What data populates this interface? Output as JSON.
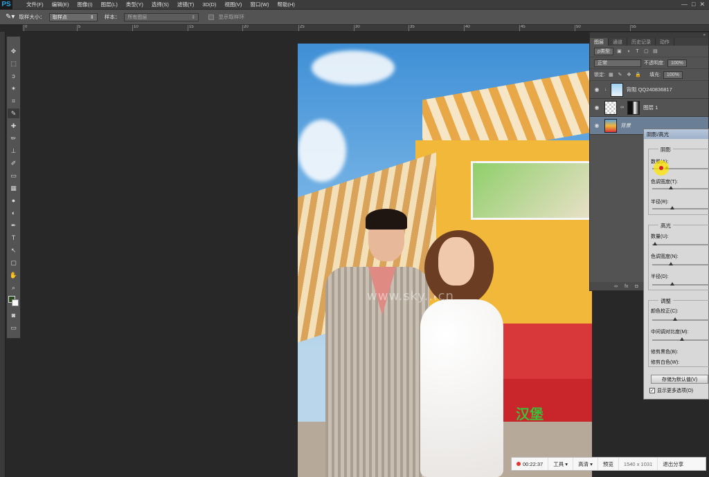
{
  "app": {
    "logo": "PS"
  },
  "menu": [
    "文件(F)",
    "编辑(E)",
    "图像(I)",
    "图层(L)",
    "类型(Y)",
    "选择(S)",
    "滤镜(T)",
    "3D(D)",
    "视图(V)",
    "窗口(W)",
    "帮助(H)"
  ],
  "window_controls": [
    "—",
    "□",
    "✕"
  ],
  "options_bar": {
    "sample_size_label": "取样大小：",
    "sample_size_value": "取样点",
    "sample_label": "样本：",
    "sample_value": "所有图层",
    "show_ring_label": "显示取样环"
  },
  "ruler_ticks": [
    "0",
    "5",
    "10",
    "15",
    "20",
    "25",
    "30",
    "35",
    "40",
    "45",
    "50",
    "55"
  ],
  "tools": [
    "move-icon",
    "marquee-icon",
    "lasso-icon",
    "magic-wand-icon",
    "crop-icon",
    "eyedropper-icon",
    "healing-icon",
    "brush-icon",
    "stamp-icon",
    "history-brush-icon",
    "eraser-icon",
    "gradient-icon",
    "blur-icon",
    "dodge-icon",
    "pen-icon",
    "type-icon",
    "path-select-icon",
    "shape-icon",
    "hand-icon",
    "zoom-icon"
  ],
  "tool_glyphs": [
    "✥",
    "⬚",
    "ↄ",
    "✶",
    "⌗",
    "✎",
    "✚",
    "✏",
    "⊥",
    "✐",
    "▭",
    "▦",
    "●",
    "◐",
    "✒",
    "T",
    "↖",
    "▢",
    "✋",
    "⌕"
  ],
  "colors": {
    "foreground": "#2d4a1f",
    "background": "#ffffff",
    "accent": "#2aa4e8"
  },
  "photo": {
    "watermark": "www.sky...cn",
    "sign_text": "汉堡"
  },
  "layers_panel": {
    "tabs": [
      "图层",
      "通道",
      "历史记录",
      "动作"
    ],
    "kind_label": "ρ类型",
    "blend_mode": "正常",
    "opacity_label": "不透明度:",
    "opacity_value": "100%",
    "lock_label": "锁定:",
    "fill_label": "填充:",
    "fill_value": "100%",
    "layers": [
      {
        "name": "背阻 QQ240836817",
        "thumb": "blue",
        "selected": false
      },
      {
        "name": "图层 1",
        "thumb": "checker",
        "selected": false
      },
      {
        "name": "背景",
        "thumb": "photo",
        "selected": true
      }
    ],
    "footer_icons": [
      "∞",
      "fx",
      "◘",
      "◑",
      "▭",
      "▤",
      "🗑"
    ]
  },
  "dialog": {
    "title": "阴影/高光",
    "shadows": {
      "title": "阴影",
      "amount": "数量(A):",
      "tone": "色调宽度(T):",
      "radius": "半径(R):"
    },
    "highlights": {
      "title": "高光",
      "amount": "数量(U):",
      "tone": "色调宽度(N):",
      "radius": "半径(D):"
    },
    "adjust": {
      "title": "调整",
      "color": "颜色校正(C):",
      "midtone": "中间调对比度(M):",
      "black": "修剪黑色(B):",
      "white": "修剪白色(W):"
    },
    "save_default": "存储为默认值(V)",
    "show_more": "显示更多选项(O)",
    "show_more_checked": "✓"
  },
  "recorder": {
    "time": "00:22:37",
    "tools": "工具 ▾",
    "quality": "高清 ▾",
    "preview": "预览",
    "resolution": "1540 x 1031",
    "exit": "退出分享"
  }
}
